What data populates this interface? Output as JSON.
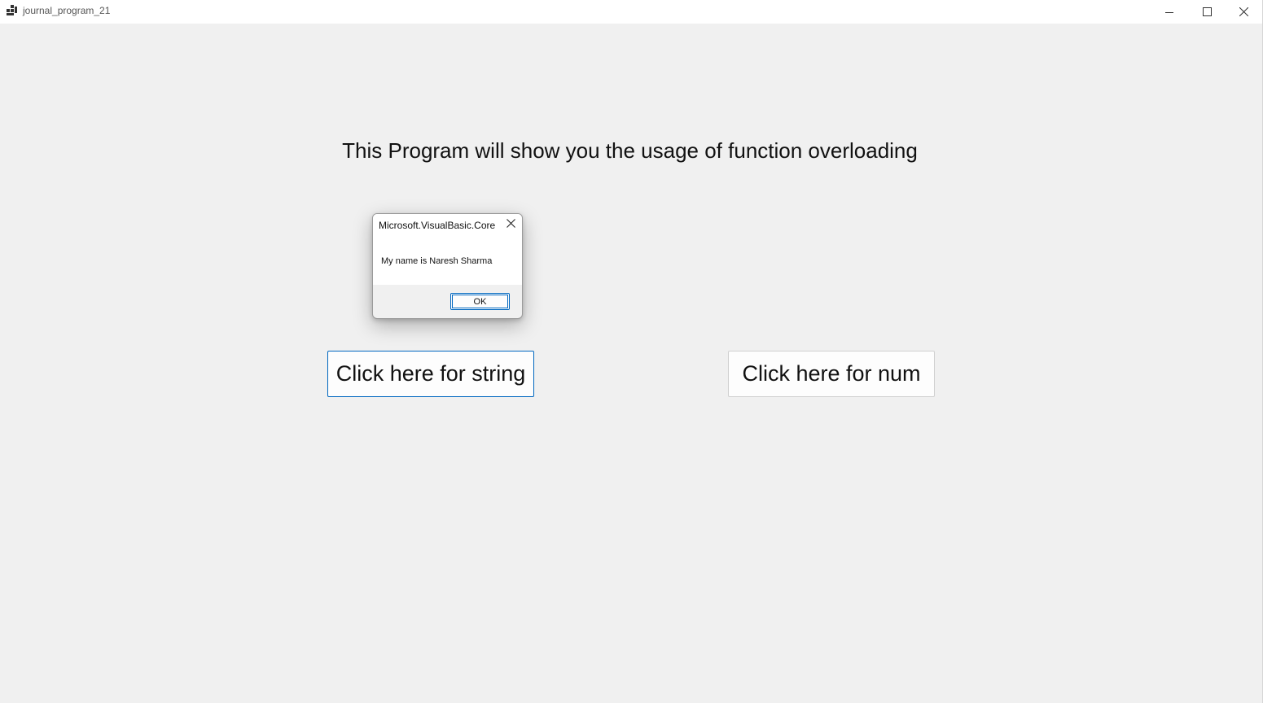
{
  "window": {
    "title": "journal_program_21",
    "icon": "app-icon",
    "controls": {
      "minimize_icon": "minimize-icon",
      "maximize_icon": "maximize-icon",
      "close_icon": "close-icon"
    }
  },
  "main": {
    "heading": "This Program will show you the usage of function overloading",
    "buttons": {
      "string_label": "Click here for string",
      "num_label": "Click here for num"
    }
  },
  "dialog": {
    "title": "Microsoft.VisualBasic.Core",
    "message": "My name is Naresh Sharma",
    "ok_label": "OK",
    "close_icon": "close-icon"
  },
  "colors": {
    "accent": "#0067c0",
    "background": "#f0f0f0",
    "titlebar": "#ffffff"
  }
}
